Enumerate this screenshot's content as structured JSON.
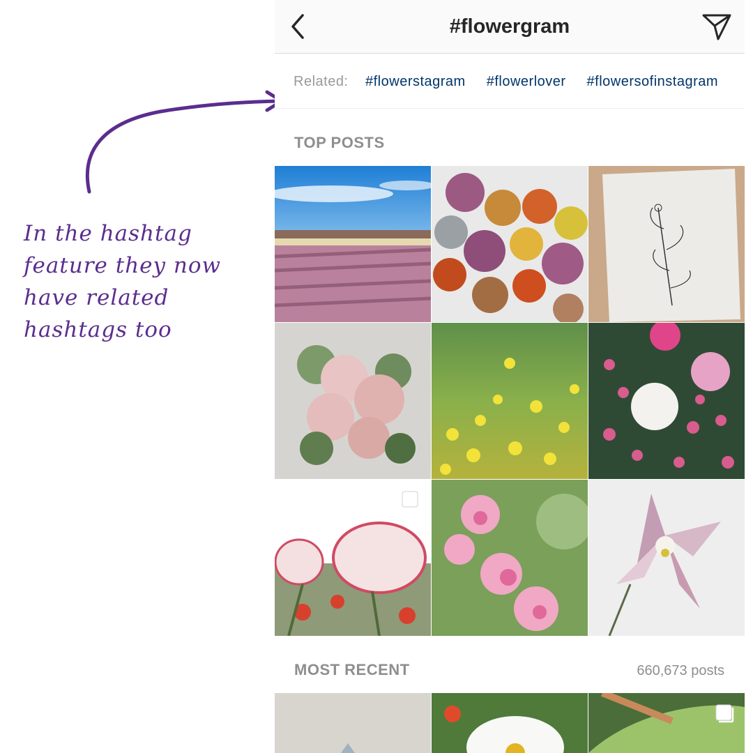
{
  "annotation": {
    "note": "In the hashtag feature they now have related hashtags too",
    "color": "#5b2d8e"
  },
  "header": {
    "back_icon": "chevron-left-icon",
    "title": "#flowergram",
    "share_icon": "paper-plane-icon"
  },
  "related": {
    "label": "Related:",
    "tags": [
      "#flowerstagram",
      "#flowerlover",
      "#flowersofinstagram"
    ]
  },
  "top_posts": {
    "title": "TOP POSTS",
    "posts": [
      {
        "subject": "purple flower field under blue sky"
      },
      {
        "subject": "flower cupcakes arrangement"
      },
      {
        "subject": "botanical sketch on paper"
      },
      {
        "subject": "pink rose bouquet"
      },
      {
        "subject": "yellow wildflower meadow"
      },
      {
        "subject": "peonies in pink and white",
        "multi": true
      },
      {
        "subject": "pink and white poppies",
        "multi": true
      },
      {
        "subject": "pink cherry blossoms"
      },
      {
        "subject": "pink columbine flower"
      }
    ]
  },
  "most_recent": {
    "title": "MOST RECENT",
    "count": "660,673 posts",
    "posts": [
      {
        "subject": "beige surface"
      },
      {
        "subject": "white daisies"
      },
      {
        "subject": "green leaves",
        "multi": true
      }
    ]
  },
  "colors": {
    "link": "#003569",
    "muted": "#8e8e8e",
    "text": "#262626"
  }
}
